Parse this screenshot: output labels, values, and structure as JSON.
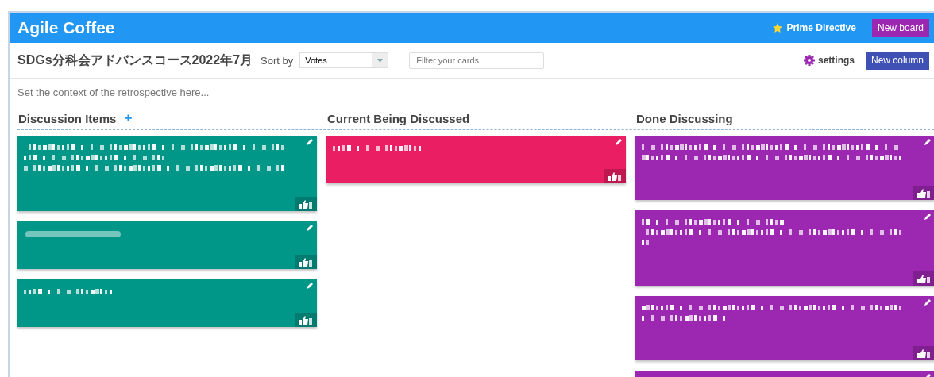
{
  "app": {
    "title": "Agile Coffee",
    "prime_directive": "Prime Directive",
    "new_board": "New board"
  },
  "toolbar": {
    "board_title": "SDGs分科会アドバンスコース2022年7月",
    "sort_label": "Sort by",
    "sort_value": "Votes",
    "filter": {
      "placeholder": "Filter your cards"
    },
    "settings": "settings",
    "new_column": "New column"
  },
  "context": {
    "placeholder": "Set the context of the retrospective here..."
  },
  "columns": [
    {
      "title": "Discussion Items",
      "add": "+",
      "color": "#009688",
      "cards": [
        {
          "lines": [
            {
              "kind": "full"
            },
            {
              "kind": "half"
            },
            {
              "kind": "full"
            }
          ],
          "editable": true
        },
        {
          "lines": [
            {
              "kind": "blur"
            }
          ],
          "editable": true
        },
        {
          "lines": [
            {
              "kind": "short"
            }
          ],
          "editable": true
        }
      ]
    },
    {
      "title": "Current Being Discussed",
      "color": "#e91e63",
      "cards": [
        {
          "lines": [
            {
              "kind": "short"
            }
          ],
          "editable": true
        }
      ]
    },
    {
      "title": "Done Discussing",
      "color": "#9c27b0",
      "cards": [
        {
          "lines": [
            {
              "kind": "full"
            },
            {
              "kind": "full"
            }
          ],
          "editable": true
        },
        {
          "lines": [
            {
              "kind": "half"
            },
            {
              "kind": "full"
            },
            {
              "kind": "tiny"
            }
          ],
          "editable": true
        },
        {
          "lines": [
            {
              "kind": "full"
            },
            {
              "kind": "short"
            }
          ],
          "editable": true
        },
        {
          "editable": true
        }
      ]
    }
  ]
}
